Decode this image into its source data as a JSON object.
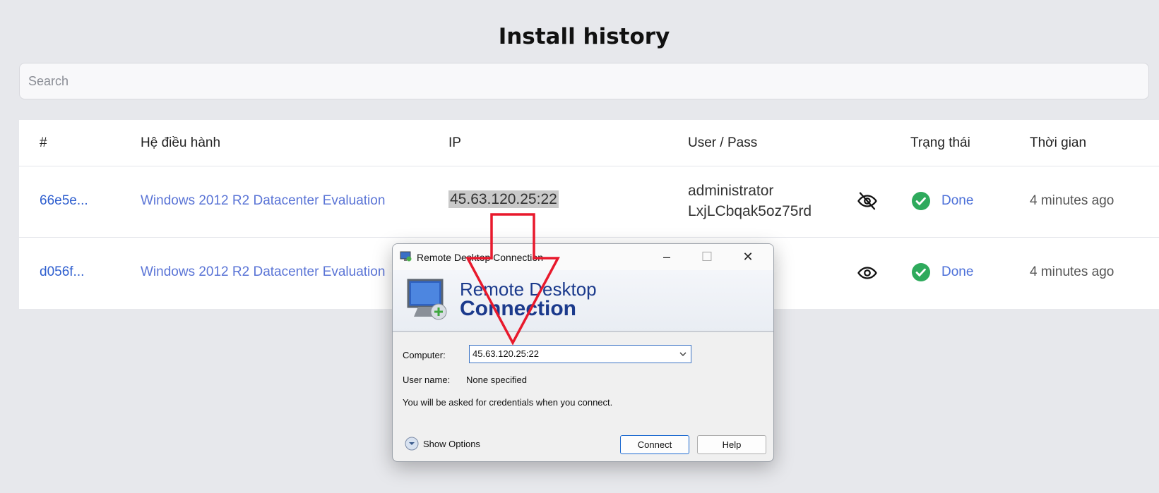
{
  "page": {
    "title": "Install history"
  },
  "search": {
    "placeholder": "Search"
  },
  "table": {
    "headers": [
      "#",
      "Hệ điều hành",
      "IP",
      "User / Pass",
      "Trạng thái",
      "Thời gian"
    ],
    "rows": [
      {
        "id": "66e5e...",
        "os": "Windows 2012 R2 Datacenter Evaluation",
        "ip": "45.63.120.25:22",
        "user": "administrator",
        "pass": "LxjLCbqak5oz75rd",
        "eye_icon": "eye-slash-icon",
        "status": "Done",
        "time": "4 minutes ago"
      },
      {
        "id": "d056f...",
        "os": "Windows 2012 R2 Datacenter Evaluation",
        "ip": "",
        "user": "",
        "pass": "",
        "eye_icon": "eye-icon",
        "status": "Done",
        "time": "4 minutes ago"
      }
    ]
  },
  "colors": {
    "accent": "#2f5fcf",
    "success": "#2eaa5c",
    "arrow": "#e8192c"
  },
  "dialog": {
    "title": "Remote Desktop Connection",
    "banner_line1": "Remote Desktop",
    "banner_line2": "Connection",
    "computer_label": "Computer:",
    "computer_value": "45.63.120.25:22",
    "username_label": "User name:",
    "username_value": "None specified",
    "note": "You will be asked for credentials when you connect.",
    "show_options": "Show Options",
    "connect": "Connect",
    "help": "Help"
  }
}
